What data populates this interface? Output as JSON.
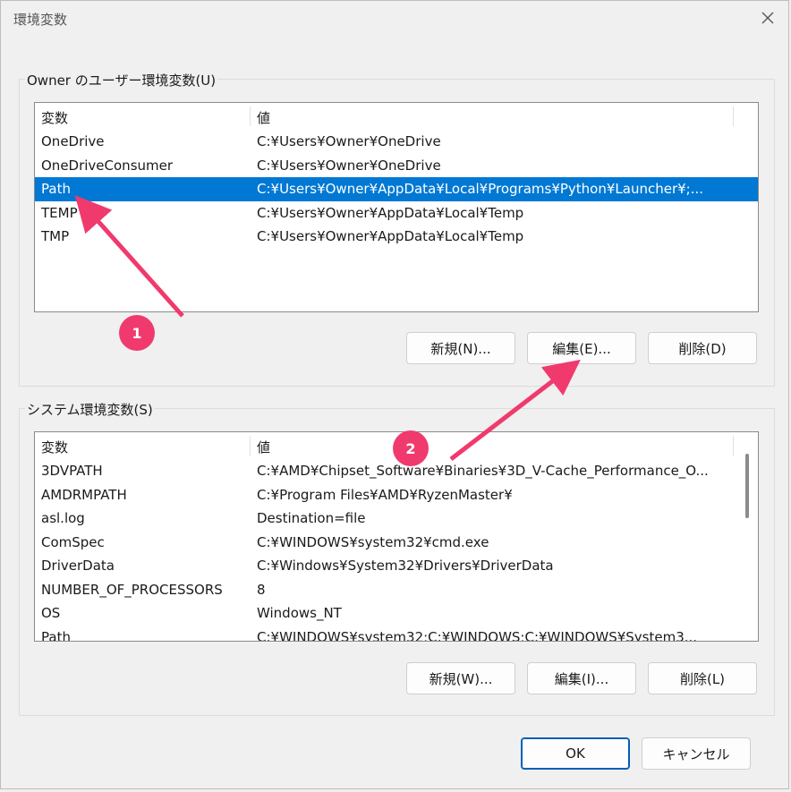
{
  "window": {
    "title": "環境変数"
  },
  "user_vars": {
    "group_label": "Owner のユーザー環境変数(U)",
    "columns": [
      "変数",
      "値"
    ],
    "rows": [
      {
        "name": "OneDrive",
        "value": "C:¥Users¥Owner¥OneDrive"
      },
      {
        "name": "OneDriveConsumer",
        "value": "C:¥Users¥Owner¥OneDrive"
      },
      {
        "name": "Path",
        "value": "C:¥Users¥Owner¥AppData¥Local¥Programs¥Python¥Launcher¥;..."
      },
      {
        "name": "TEMP",
        "value": "C:¥Users¥Owner¥AppData¥Local¥Temp"
      },
      {
        "name": "TMP",
        "value": "C:¥Users¥Owner¥AppData¥Local¥Temp"
      }
    ],
    "selected_row": "Path",
    "buttons": {
      "new": "新規(N)...",
      "edit": "編集(E)...",
      "delete": "削除(D)"
    }
  },
  "system_vars": {
    "group_label": "システム環境変数(S)",
    "columns": [
      "変数",
      "値"
    ],
    "rows": [
      {
        "name": "3DVPATH",
        "value": "C:¥AMD¥Chipset_Software¥Binaries¥3D_V-Cache_Performance_O..."
      },
      {
        "name": "AMDRMPATH",
        "value": "C:¥Program Files¥AMD¥RyzenMaster¥"
      },
      {
        "name": "asl.log",
        "value": "Destination=file"
      },
      {
        "name": "ComSpec",
        "value": "C:¥WINDOWS¥system32¥cmd.exe"
      },
      {
        "name": "DriverData",
        "value": "C:¥Windows¥System32¥Drivers¥DriverData"
      },
      {
        "name": "NUMBER_OF_PROCESSORS",
        "value": "8"
      },
      {
        "name": "OS",
        "value": "Windows_NT"
      },
      {
        "name": "Path",
        "value": "C:¥WINDOWS¥system32;C:¥WINDOWS;C:¥WINDOWS¥System3..."
      }
    ],
    "buttons": {
      "new": "新規(W)...",
      "edit": "編集(I)...",
      "delete": "削除(L)"
    }
  },
  "footer": {
    "ok": "OK",
    "cancel": "キャンセル"
  },
  "annotations": {
    "badge1": "1",
    "badge2": "2",
    "color": "#f03a6e"
  },
  "icons": {
    "close": "close-icon"
  },
  "colors": {
    "selection": "#0078d4",
    "primary_border": "#005fb8"
  }
}
